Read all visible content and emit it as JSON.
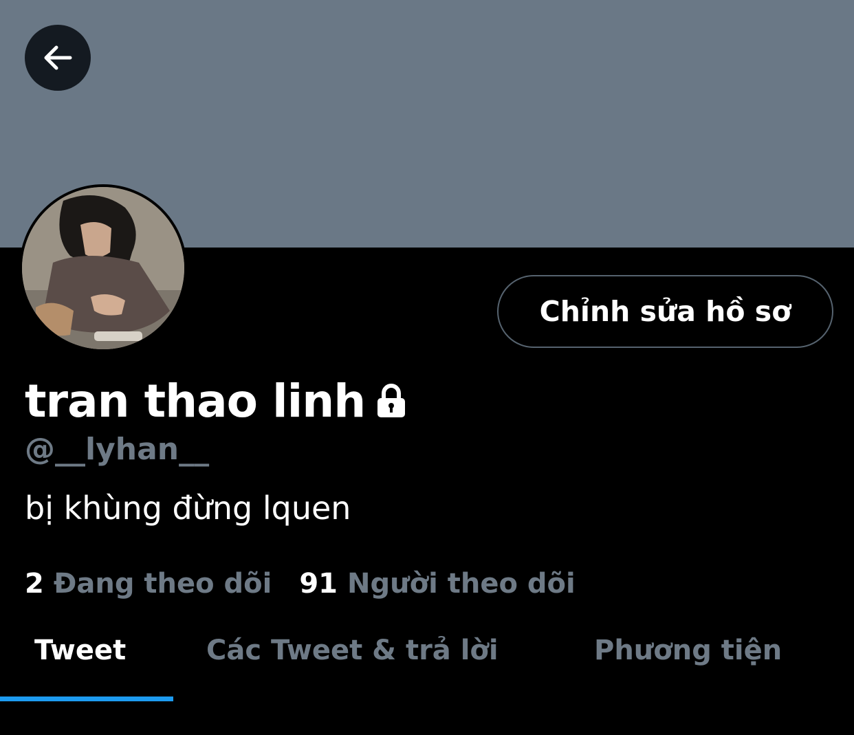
{
  "profile": {
    "display_name": "tran thao linh",
    "handle": "@__lyhan__",
    "bio": "bị khùng đừng lquen",
    "edit_button": "Chỉnh sửa hồ sơ"
  },
  "stats": {
    "following_count": "2",
    "following_label": "Đang theo dõi",
    "followers_count": "91",
    "followers_label": "Người theo dõi"
  },
  "tabs": [
    {
      "label": "Tweet",
      "active": true
    },
    {
      "label": "Các Tweet & trả lời",
      "active": false
    },
    {
      "label": "Phương tiện",
      "active": false
    }
  ],
  "icons": {
    "back": "arrow-left-icon",
    "lock": "lock-icon"
  },
  "colors": {
    "banner": "#6a7886",
    "background": "#000000",
    "muted_text": "#6e7a86",
    "accent": "#1d9bf0"
  }
}
